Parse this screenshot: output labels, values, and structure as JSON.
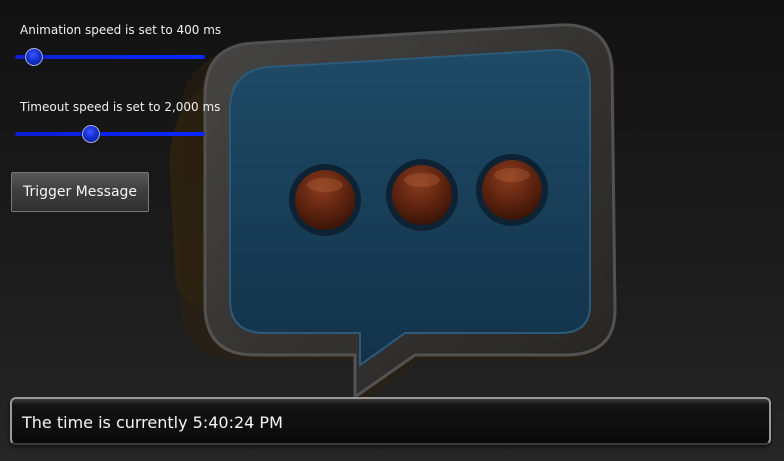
{
  "controls": {
    "animation_label": "Animation speed is set to 400 ms",
    "animation_level": 0.1,
    "timeout_label": "Timeout speed is set to 2,000 ms",
    "timeout_level": 0.4,
    "trigger_label": "Trigger Message"
  },
  "status": {
    "text": "The time is currently 5:40:24 PM"
  },
  "colors": {
    "slider_accent": "#0b28ff",
    "bubble_fill": "#1a3f57",
    "dot_fill": "#6a2a15"
  },
  "icons": {
    "background": "speech-bubble-icon"
  }
}
